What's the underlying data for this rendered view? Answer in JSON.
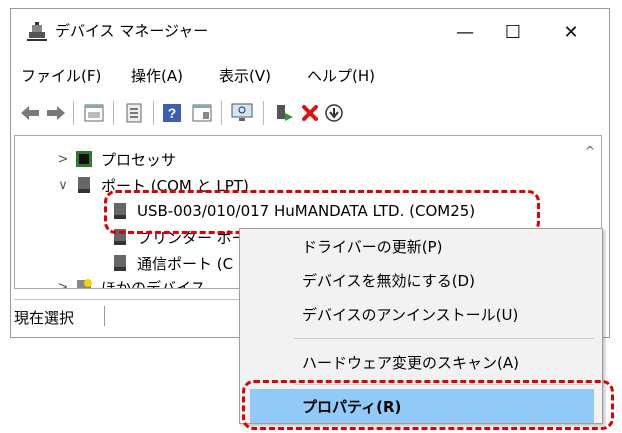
{
  "window": {
    "title": "デバイス マネージャー",
    "minimize_glyph": "—",
    "maximize_glyph": "☐",
    "close_glyph": "✕"
  },
  "menu": {
    "items": [
      "ファイル(F)",
      "操作(A)",
      "表示(V)",
      "ヘルプ(H)"
    ]
  },
  "toolbar": {
    "icons": [
      "back-arrow-icon",
      "forward-arrow-icon",
      "properties-view-icon",
      "list-view-icon",
      "help-icon",
      "update-driver-icon",
      "monitor-scan-icon",
      "enable-device-icon",
      "uninstall-x-icon",
      "download-driver-icon"
    ]
  },
  "tree": {
    "processors": "プロセッサ",
    "ports": "ポート (COM と LPT)",
    "usb_device": "USB-003/010/017 HuMANDATA LTD. (COM25)",
    "printer_port": "プリンター ポート",
    "comm_port": "通信ポート (C",
    "other_devices": "ほかのデバイス",
    "expand_glyph": ">",
    "collapse_glyph": "∨"
  },
  "status": {
    "text": "現在選択"
  },
  "context_menu": {
    "items": [
      "ドライバーの更新(P)",
      "デバイスを無効にする(D)",
      "デバイスのアンインストール(U)",
      "ハードウェア変更のスキャン(A)",
      "プロパティ(R)"
    ]
  },
  "colors": {
    "highlight": "#91c9f7",
    "annotation": "#e00000",
    "delete_red": "#e01010",
    "processor_green": "#2c7a2c"
  }
}
